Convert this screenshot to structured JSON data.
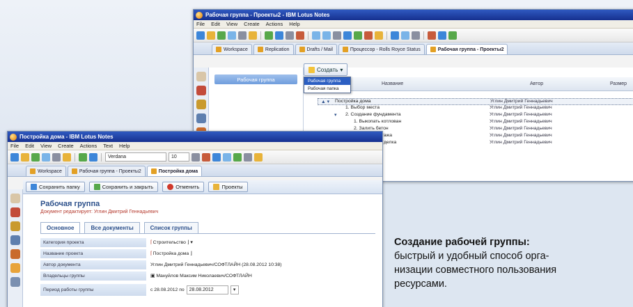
{
  "back_window": {
    "title": "Рабочая группа - Проекты2 - IBM Lotus Notes",
    "menu": [
      "File",
      "Edit",
      "View",
      "Create",
      "Actions",
      "Help"
    ],
    "tabs": [
      "Workspace",
      "Replication",
      "Drafts / Mail",
      "Процессор - Rolls Royce Status",
      "Рабочая группа - Проекты2"
    ],
    "nav_selected": "Рабочая группа",
    "create_button": "Создать",
    "dropdown_items": [
      "Рабочая группа",
      "Рабочая папка"
    ],
    "columns": {
      "name": "Название",
      "author": "Автор",
      "size": "Размер"
    },
    "rows": [
      {
        "name": "Постройка дома",
        "author": "Углин Дмитрий Геннадьевич",
        "indent": 0
      },
      {
        "name": "1. Выбор места",
        "author": "Углин Дмитрий Геннадьевич",
        "indent": 1
      },
      {
        "name": "2. Создание фундамента",
        "author": "Углин Дмитрий Геннадьевич",
        "indent": 1
      },
      {
        "name": "1. Выкопать котлован",
        "author": "Углин Дмитрий Геннадьевич",
        "indent": 2
      },
      {
        "name": "2. Залить бетон",
        "author": "Углин Дмитрий Геннадьевич",
        "indent": 2
      },
      {
        "name": "3. Постройка 1 этажа",
        "author": "Углин Дмитрий Геннадьевич",
        "indent": 1
      },
      {
        "name": "4. Внутренняя Отделка",
        "author": "Углин Дмитрий Геннадьевич",
        "indent": 1
      }
    ]
  },
  "front_window": {
    "title": "Постройка дома - IBM Lotus Notes",
    "menu": [
      "File",
      "Edit",
      "View",
      "Create",
      "Actions",
      "Text",
      "Help"
    ],
    "font_name": "Verdana",
    "font_size": "10",
    "tabs": [
      "Workspace",
      "Рабочая группа - Проекты2",
      "Постройка дома"
    ],
    "action_buttons": [
      "Сохранить папку",
      "Сохранить и закрыть",
      "Отменить",
      "Проекты"
    ],
    "form_title": "Рабочая группа",
    "form_subtitle": "Документ редактирует: Углин Дмитрий Геннадьевич",
    "form_tabs": [
      "Основное",
      "Все документы",
      "Список группы"
    ],
    "fields": [
      {
        "label": "Категория проекта",
        "value": "Строительство"
      },
      {
        "label": "Название проекта",
        "value": "Постройка дома"
      },
      {
        "label": "Автор документа",
        "value": "Углин Дмитрий Геннадьевич/СОФТЛАЙН (28.08.2012 10:38)"
      },
      {
        "label": "Владельцы группы",
        "value": "Мануйлов Максим Николаевич/СОФТЛАЙН"
      },
      {
        "label": "Период работы группы",
        "value_prefix": "с 28.08.2012 по",
        "value": "28.08.2012"
      }
    ]
  },
  "caption": {
    "heading": "Создание рабочей группы:",
    "lines": [
      "быстрый и удобный способ орга-",
      "низации совместного пользования",
      "ресурсами."
    ]
  }
}
